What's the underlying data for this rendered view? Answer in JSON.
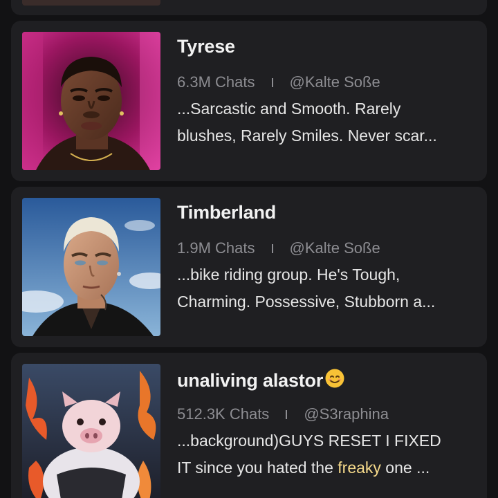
{
  "cards": [
    {
      "title": "Tyrese",
      "chats": "6.3M Chats",
      "author": "@Kalte Soße",
      "desc_line1": "...Sarcastic and Smooth. Rarely",
      "desc_line2": "blushes, Rarely Smiles. Never scar..."
    },
    {
      "title": "Timberland",
      "chats": "1.9M Chats",
      "author": "@Kalte Soße",
      "desc_line1": "...bike riding group. He's Tough,",
      "desc_line2": "Charming. Possessive, Stubborn a..."
    },
    {
      "title": "unaliving alastor",
      "title_emoji": "smiling-face-emoji",
      "chats": "512.3K Chats",
      "author": "@S3raphina",
      "desc_line1": "...background)GUYS RESET I FIXED",
      "desc_line2_pre": "IT since you hated the ",
      "desc_line2_highlight": "freaky",
      "desc_line2_post": " one ..."
    }
  ],
  "colors": {
    "background": "#121214",
    "card": "#1f1f22",
    "title": "#f2f2f2",
    "meta": "#8d8d92",
    "description": "#e6e6e6",
    "highlight": "#f5d98a"
  }
}
